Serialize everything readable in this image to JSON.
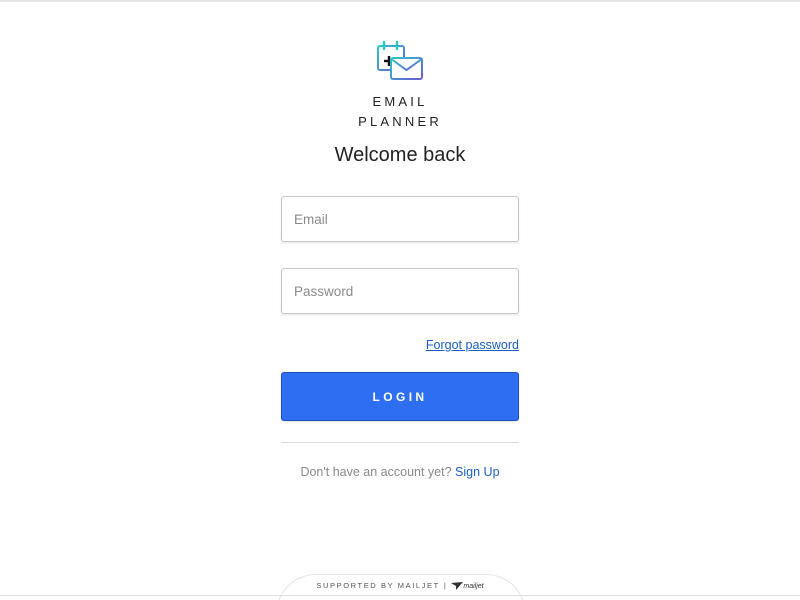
{
  "brand": {
    "line1": "EMAIL",
    "line2": "PLANNER",
    "logo_icon": "calendar-envelope-icon",
    "logo_colors": [
      "#2bc6c6",
      "#6a5cd6"
    ]
  },
  "heading": "Welcome back",
  "form": {
    "email_placeholder": "Email",
    "email_value": "",
    "password_placeholder": "Password",
    "password_value": "",
    "forgot_label": "Forgot password",
    "login_label": "LOGIN"
  },
  "signup": {
    "prompt": "Don't have an account yet?",
    "link": "Sign Up"
  },
  "footer": {
    "supported": "SUPPORTED BY MAILJET",
    "separator": "|",
    "mailjet_logo": "mailjet"
  },
  "colors": {
    "accent": "#2e6ff2",
    "link": "#1a5fc7"
  }
}
